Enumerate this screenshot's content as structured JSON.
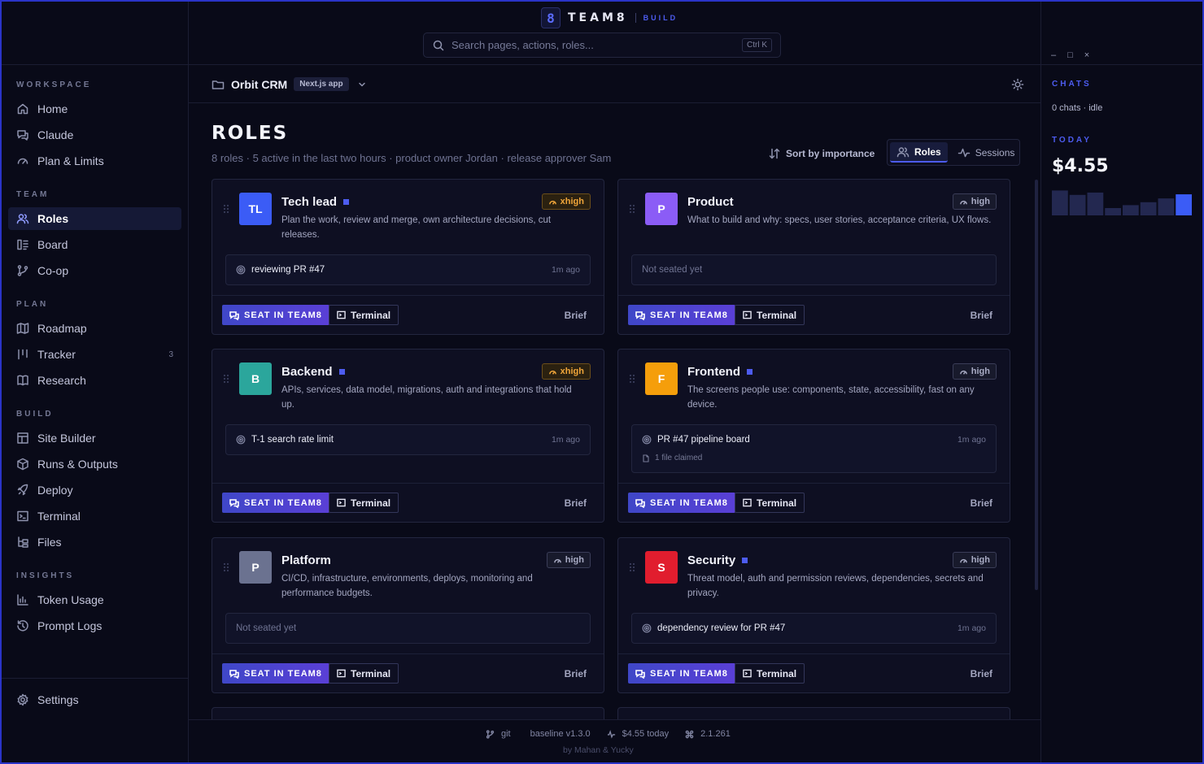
{
  "app": {
    "brand_mark": "8",
    "brand_name": "TEAM8",
    "brand_sub": "BUILD",
    "search_placeholder": "Search pages, actions, roles...",
    "search_shortcut": "Ctrl K"
  },
  "sidebar": {
    "workspace_label": "WORKSPACE",
    "team_label": "TEAM",
    "plan_label": "PLAN",
    "build_label": "BUILD",
    "insights_label": "INSIGHTS",
    "items": {
      "home": "Home",
      "claude": "Claude",
      "plan_limits": "Plan & Limits",
      "roles": "Roles",
      "board": "Board",
      "coop": "Co-op",
      "roadmap": "Roadmap",
      "tracker": "Tracker",
      "tracker_count": "3",
      "research": "Research",
      "site_builder": "Site Builder",
      "runs_outputs": "Runs & Outputs",
      "deploy": "Deploy",
      "terminal": "Terminal",
      "files": "Files",
      "token_usage": "Token Usage",
      "prompt_logs": "Prompt Logs",
      "settings": "Settings"
    },
    "active_item": "roles"
  },
  "project": {
    "name": "Orbit CRM",
    "badge": "Next.js app"
  },
  "page": {
    "title": "ROLES",
    "subtitle": "8 roles · 5 active in the last two hours · product owner Jordan · release approver Sam",
    "sort_label": "Sort by importance",
    "view_roles": "Roles",
    "view_sessions": "Sessions"
  },
  "card_actions": {
    "seat": "SEAT IN TEAM8",
    "terminal": "Terminal",
    "brief": "Brief",
    "not_seated": "Not seated yet"
  },
  "roles": [
    {
      "initials": "TL",
      "name": "Tech lead",
      "active": true,
      "color": "#3b5cf6",
      "effort": "xhigh",
      "description": "Plan the work, review and merge, own architecture decisions, cut releases.",
      "status": "reviewing PR #47",
      "time": "1m ago",
      "sub": ""
    },
    {
      "initials": "P",
      "name": "Product",
      "active": false,
      "color": "#8b5cf6",
      "effort": "high",
      "description": "What to build and why: specs, user stories, acceptance criteria, UX flows.",
      "status": "",
      "time": "",
      "sub": ""
    },
    {
      "initials": "B",
      "name": "Backend",
      "active": true,
      "color": "#2ba69c",
      "effort": "xhigh",
      "description": "APIs, services, data model, migrations, auth and integrations that hold up.",
      "status": "T-1 search rate limit",
      "time": "1m ago",
      "sub": ""
    },
    {
      "initials": "F",
      "name": "Frontend",
      "active": true,
      "color": "#f59e0b",
      "effort": "high",
      "description": "The screens people use: components, state, accessibility, fast on any device.",
      "status": "PR #47 pipeline board",
      "time": "1m ago",
      "sub": "1 file claimed"
    },
    {
      "initials": "P",
      "name": "Platform",
      "active": false,
      "color": "#6b7290",
      "effort": "high",
      "description": "CI/CD, infrastructure, environments, deploys, monitoring and performance budgets.",
      "status": "",
      "time": "",
      "sub": ""
    },
    {
      "initials": "S",
      "name": "Security",
      "active": true,
      "color": "#e11d2e",
      "effort": "high",
      "description": "Threat model, auth and permission reviews, dependencies, secrets and privacy.",
      "status": "dependency review for PR #47",
      "time": "1m ago",
      "sub": ""
    }
  ],
  "statusbar": {
    "git_label": "git",
    "version": "baseline v1.3.0",
    "cost_today": "$4.55 today",
    "build": "2.1.261",
    "credit": "by Mahan & Yucky"
  },
  "right_panel": {
    "chats_label": "CHATS",
    "chats_status": "0 chats · idle",
    "today_label": "TODAY",
    "today_amount": "$4.55",
    "spend_bars": [
      0.85,
      0.7,
      0.78,
      0.25,
      0.35,
      0.45,
      0.58,
      0.72
    ],
    "bar_color": "#232850",
    "bar_highlight": "#3b5cf6"
  },
  "window_controls": {
    "minimize": "–",
    "maximize": "□",
    "close": "×"
  },
  "colors": {
    "accent": "#4d5cf0",
    "background": "#090a18"
  }
}
